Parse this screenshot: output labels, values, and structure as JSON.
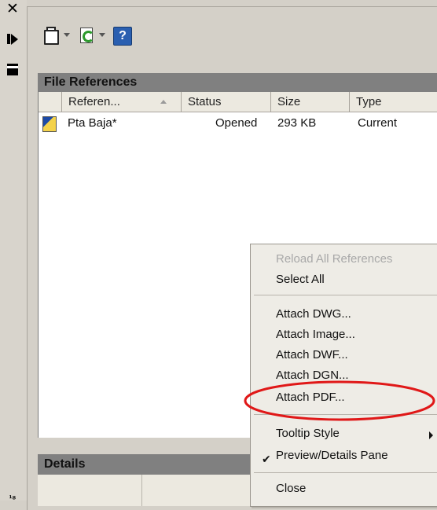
{
  "side_strip": {
    "close_icon": "close-icon",
    "auto_hide_icon": "auto-hide-icon",
    "properties_icon": "properties-icon"
  },
  "toolbar": {
    "attach_icon": "attach-icon",
    "refresh_icon": "refresh-icon",
    "help_icon": "help-icon",
    "help_glyph": "?"
  },
  "file_references": {
    "title": "File References",
    "columns": [
      "Referen...",
      "Status",
      "Size",
      "Type"
    ],
    "rows": [
      {
        "name": "Pta Baja*",
        "status": "Opened",
        "size": "293 KB",
        "type": "Current"
      }
    ]
  },
  "details": {
    "title": "Details"
  },
  "context_menu": {
    "items": [
      {
        "label": "Reload All References",
        "disabled": true
      },
      {
        "label": "Select All"
      },
      {
        "label": "Attach DWG..."
      },
      {
        "label": "Attach Image..."
      },
      {
        "label": "Attach DWF..."
      },
      {
        "label": "Attach DGN..."
      },
      {
        "label": "Attach PDF...",
        "highlighted": true
      },
      {
        "label": "Tooltip Style",
        "submenu": true
      },
      {
        "label": "Preview/Details Pane",
        "checked": true
      },
      {
        "label": "Close"
      }
    ]
  },
  "colors": {
    "highlight_ellipse": "#e01818",
    "panel_header": "#808080",
    "disabled_text": "#a8a8a8"
  }
}
